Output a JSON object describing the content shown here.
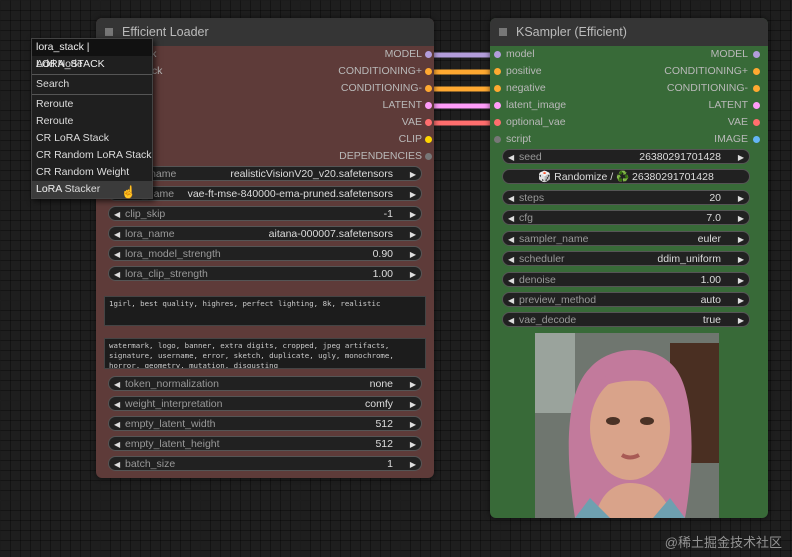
{
  "colors": {
    "loader_body": "#5e3b39",
    "ksampler_body": "#386a38",
    "model": "#b39ddb",
    "conditioning": "#ffa931",
    "latent": "#ff9cf9",
    "vae": "#ff6e6e",
    "clip": "#ffd500",
    "dependencies": "#777777",
    "script": "#777777",
    "image": "#64b5f6"
  },
  "loader": {
    "title": "Efficient Loader",
    "outputs": [
      "MODEL",
      "CONDITIONING+",
      "CONDITIONING-",
      "LATENT",
      "VAE",
      "CLIP",
      "DEPENDENCIES"
    ],
    "hidden_inputs": [
      "ck",
      "ack"
    ],
    "widgets": [
      {
        "label": "ckpt_name",
        "value": "realisticVisionV20_v20.safetensors"
      },
      {
        "label": "vae_name",
        "value": "vae-ft-mse-840000-ema-pruned.safetensors"
      },
      {
        "label": "clip_skip",
        "value": "-1"
      },
      {
        "label": "lora_name",
        "value": "aitana-000007.safetensors"
      },
      {
        "label": "lora_model_strength",
        "value": "0.90"
      },
      {
        "label": "lora_clip_strength",
        "value": "1.00"
      }
    ],
    "positive_prompt": "1girl, best quality, highres, perfect lighting, 8k, realistic",
    "negative_prompt": "watermark, logo, banner, extra digits, cropped, jpeg artifacts, signature, username, error, sketch, duplicate, ugly, monochrome, horror, geometry, mutation, disgusting",
    "widgets2": [
      {
        "label": "token_normalization",
        "value": "none"
      },
      {
        "label": "weight_interpretation",
        "value": "comfy"
      },
      {
        "label": "empty_latent_width",
        "value": "512"
      },
      {
        "label": "empty_latent_height",
        "value": "512"
      },
      {
        "label": "batch_size",
        "value": "1"
      }
    ]
  },
  "ksampler": {
    "title": "KSampler (Efficient)",
    "inputs": [
      "model",
      "positive",
      "negative",
      "latent_image",
      "optional_vae",
      "script"
    ],
    "outputs": [
      "MODEL",
      "CONDITIONING+",
      "CONDITIONING-",
      "LATENT",
      "VAE",
      "IMAGE"
    ],
    "seed": {
      "label": "seed",
      "value": "26380291701428"
    },
    "randomize_label": "🎲 Randomize / ♻️ 26380291701428",
    "widgets": [
      {
        "label": "steps",
        "value": "20"
      },
      {
        "label": "cfg",
        "value": "7.0"
      },
      {
        "label": "sampler_name",
        "value": "euler"
      },
      {
        "label": "scheduler",
        "value": "ddim_uniform"
      },
      {
        "label": "denoise",
        "value": "1.00"
      },
      {
        "label": "preview_method",
        "value": "auto"
      },
      {
        "label": "vae_decode",
        "value": "true"
      }
    ]
  },
  "context_menu": {
    "header": "lora_stack | LORA_STACK",
    "items": [
      "Add Node",
      "Search",
      "Reroute",
      "Reroute",
      "CR LoRA Stack",
      "CR Random LoRA Stack",
      "CR Random Weight LoRA",
      "LoRA Stacker"
    ],
    "highlighted": "LoRA Stacker"
  },
  "watermark": "@稀土掘金技术社区"
}
